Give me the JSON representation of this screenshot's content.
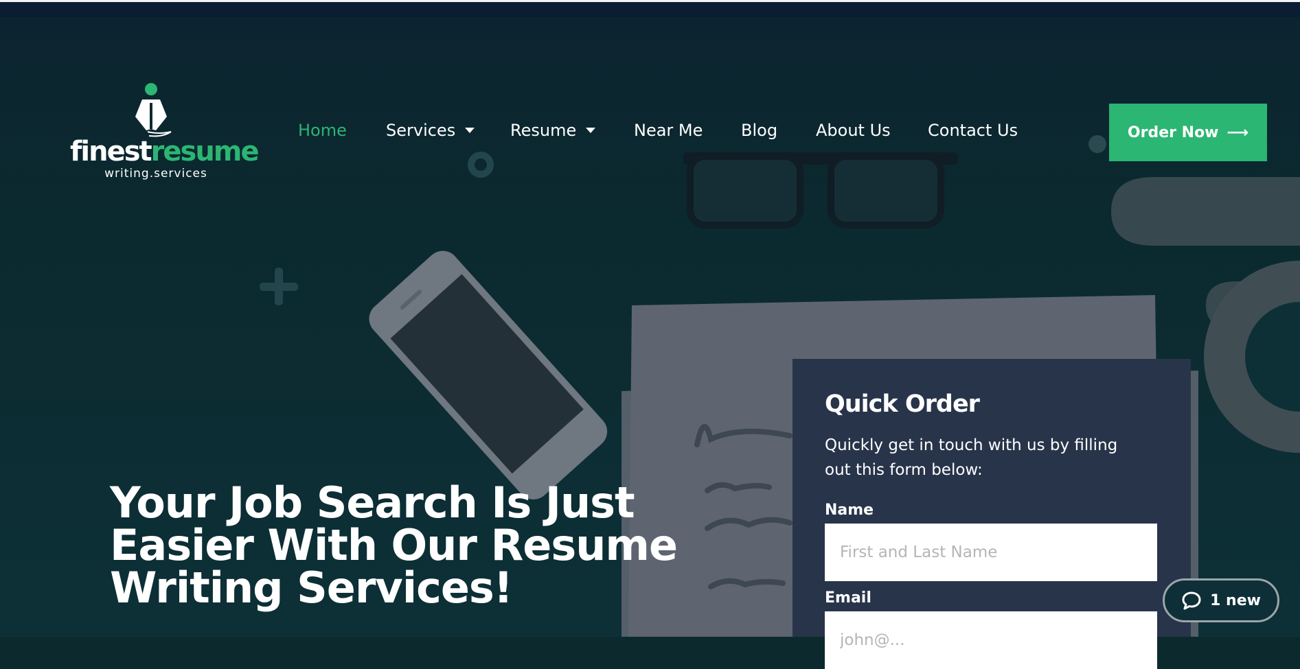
{
  "brand": {
    "word_white": "finest",
    "word_green": "resume",
    "sub": "writing.services"
  },
  "nav": {
    "items": [
      {
        "label": "Home"
      },
      {
        "label": "Services"
      },
      {
        "label": "Resume"
      },
      {
        "label": "Near Me"
      },
      {
        "label": "Blog"
      },
      {
        "label": "About Us"
      },
      {
        "label": "Contact Us"
      }
    ],
    "active": "Home"
  },
  "cta": {
    "order_label": "Order Now",
    "arrow": "⟶"
  },
  "hero": {
    "headline": "Your Job Search Is Just Easier With Our Resume Writing Services!"
  },
  "quick_order": {
    "title": "Quick Order",
    "description": "Quickly get in touch with us by filling out this form below:",
    "name_label": "Name",
    "name_placeholder": "First and Last Name",
    "email_label": "Email",
    "email_placeholder": "john@..."
  },
  "chat": {
    "label": "1 new"
  },
  "colors": {
    "accent": "#2bb673",
    "panel": "#28344a",
    "bg": "#0c2a2e",
    "topbar": "#0b1d33"
  }
}
